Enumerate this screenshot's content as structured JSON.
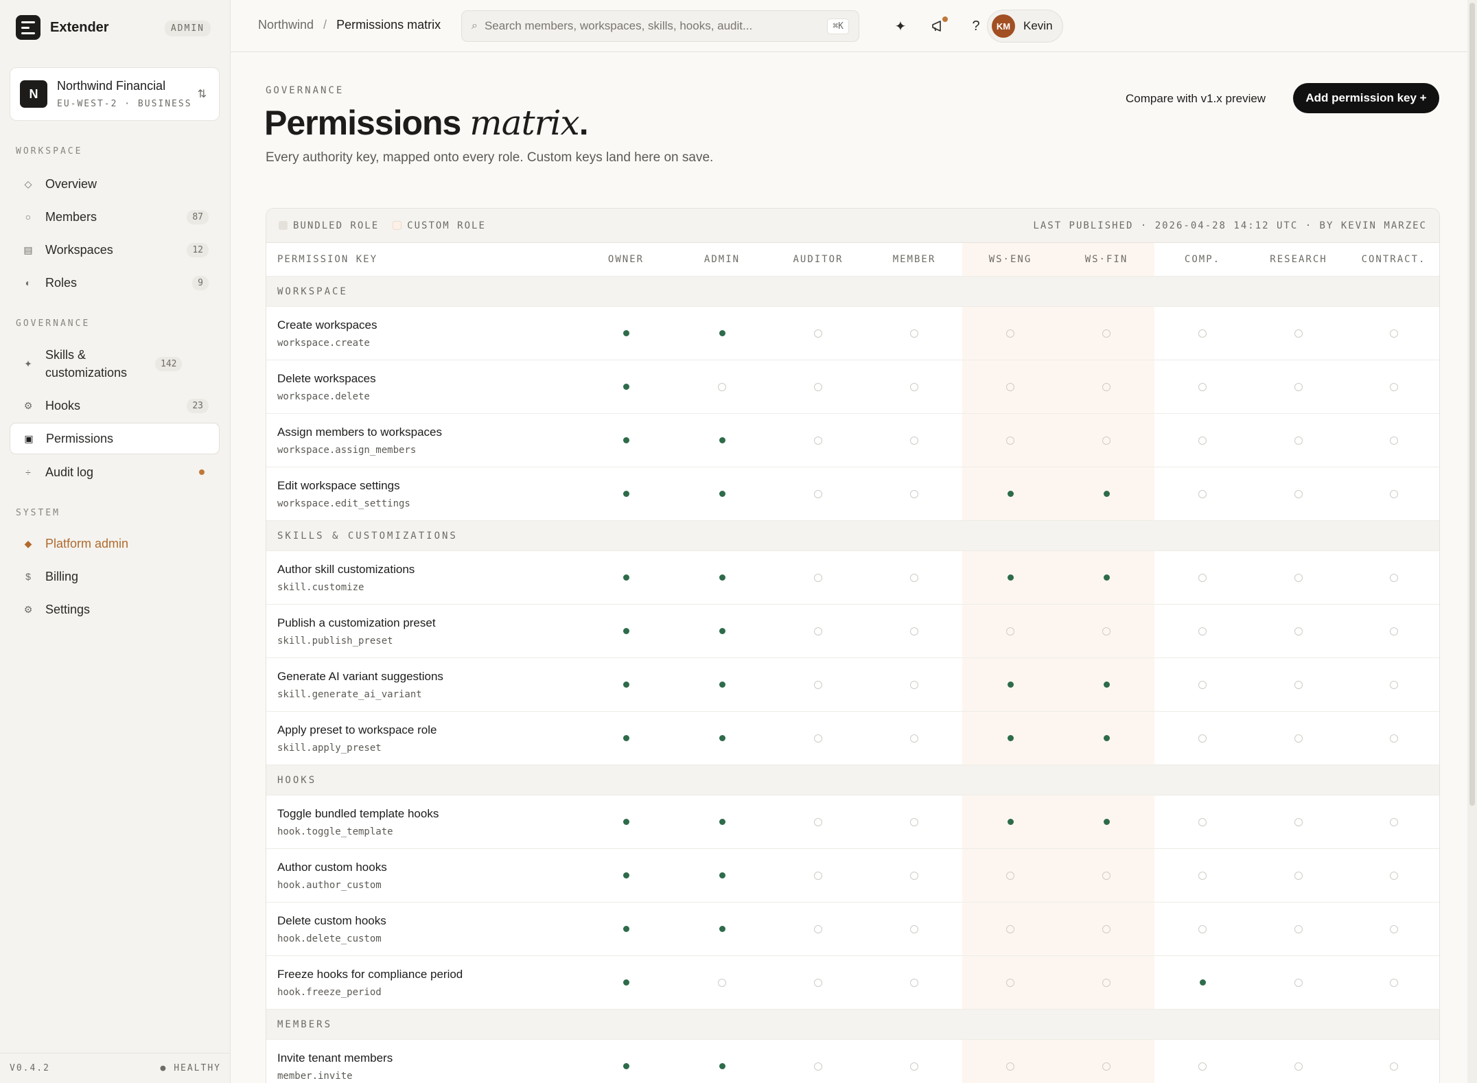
{
  "app": {
    "name": "Extender",
    "role_chip": "ADMIN",
    "version": "V0.4.2",
    "health": "● HEALTHY"
  },
  "tenant": {
    "name": "Northwind Financial",
    "meta": "EU-WEST-2 · BUSINESS",
    "initial": "N",
    "switch_icon": "⇅"
  },
  "nav": {
    "workspace_title": "WORKSPACE",
    "workspace_items": [
      {
        "label": "Overview",
        "icon": "◇",
        "count": ""
      },
      {
        "label": "Members",
        "icon": "○",
        "count": "87"
      },
      {
        "label": "Workspaces",
        "icon": "▤",
        "count": "12"
      },
      {
        "label": "Roles",
        "icon": "◐",
        "count": "9"
      }
    ],
    "governance_title": "GOVERNANCE",
    "governance_items": [
      {
        "label": "Skills & customizations",
        "icon": "✦",
        "count": "142"
      },
      {
        "label": "Hooks",
        "icon": "⚙",
        "count": "23"
      },
      {
        "label": "Permissions",
        "icon": "▣",
        "count": ""
      },
      {
        "label": "Audit log",
        "icon": "÷",
        "count": ""
      }
    ],
    "system_title": "SYSTEM",
    "system_items": [
      {
        "label": "Platform admin",
        "icon": "◆"
      },
      {
        "label": "Billing",
        "icon": "$"
      },
      {
        "label": "Settings",
        "icon": "⚙"
      }
    ]
  },
  "topbar": {
    "breadcrumb_root": "Northwind",
    "breadcrumb_sep": "/",
    "breadcrumb_current": "Permissions matrix",
    "search_placeholder": "Search members, workspaces, skills, hooks, audit...",
    "search_shortcut": "⌘K",
    "user_initials": "KM",
    "user_name": "Kevin"
  },
  "header": {
    "eyebrow": "GOVERNANCE",
    "title_main": "Permissions",
    "title_em": "matrix",
    "title_end": ".",
    "subtitle": "Every authority key, mapped onto every role. Custom keys land here on save.",
    "compare_label": "Compare with v1.x preview",
    "add_label": "Add permission key +"
  },
  "legend": {
    "bundled": "BUNDLED ROLE",
    "custom": "CUSTOM ROLE",
    "published": "LAST PUBLISHED · 2026-04-28 14:12 UTC · BY KEVIN MARZEC"
  },
  "matrix": {
    "key_header": "PERMISSION KEY",
    "roles": [
      "OWNER",
      "ADMIN",
      "AUDITOR",
      "MEMBER",
      "WS·ENG",
      "WS·FIN",
      "COMP.",
      "RESEARCH",
      "CONTRACT."
    ],
    "groups": [
      {
        "title": "WORKSPACE",
        "rows": [
          {
            "name": "Create workspaces",
            "key": "workspace.create",
            "grants": [
              1,
              1,
              0,
              0,
              0,
              0,
              0,
              0,
              0
            ]
          },
          {
            "name": "Delete workspaces",
            "key": "workspace.delete",
            "grants": [
              1,
              0,
              0,
              0,
              0,
              0,
              0,
              0,
              0
            ]
          },
          {
            "name": "Assign members to workspaces",
            "key": "workspace.assign_members",
            "grants": [
              1,
              1,
              0,
              0,
              0,
              0,
              0,
              0,
              0
            ]
          },
          {
            "name": "Edit workspace settings",
            "key": "workspace.edit_settings",
            "grants": [
              1,
              1,
              0,
              0,
              1,
              1,
              0,
              0,
              0
            ]
          }
        ]
      },
      {
        "title": "SKILLS & CUSTOMIZATIONS",
        "rows": [
          {
            "name": "Author skill customizations",
            "key": "skill.customize",
            "grants": [
              1,
              1,
              0,
              0,
              1,
              1,
              0,
              0,
              0
            ]
          },
          {
            "name": "Publish a customization preset",
            "key": "skill.publish_preset",
            "grants": [
              1,
              1,
              0,
              0,
              0,
              0,
              0,
              0,
              0
            ]
          },
          {
            "name": "Generate AI variant suggestions",
            "key": "skill.generate_ai_variant",
            "grants": [
              1,
              1,
              0,
              0,
              1,
              1,
              0,
              0,
              0
            ]
          },
          {
            "name": "Apply preset to workspace role",
            "key": "skill.apply_preset",
            "grants": [
              1,
              1,
              0,
              0,
              1,
              1,
              0,
              0,
              0
            ]
          }
        ]
      },
      {
        "title": "HOOKS",
        "rows": [
          {
            "name": "Toggle bundled template hooks",
            "key": "hook.toggle_template",
            "grants": [
              1,
              1,
              0,
              0,
              1,
              1,
              0,
              0,
              0
            ]
          },
          {
            "name": "Author custom hooks",
            "key": "hook.author_custom",
            "grants": [
              1,
              1,
              0,
              0,
              0,
              0,
              0,
              0,
              0
            ]
          },
          {
            "name": "Delete custom hooks",
            "key": "hook.delete_custom",
            "grants": [
              1,
              1,
              0,
              0,
              0,
              0,
              0,
              0,
              0
            ]
          },
          {
            "name": "Freeze hooks for compliance period",
            "key": "hook.freeze_period",
            "grants": [
              1,
              0,
              0,
              0,
              0,
              0,
              1,
              0,
              0
            ]
          }
        ]
      },
      {
        "title": "MEMBERS",
        "rows": [
          {
            "name": "Invite tenant members",
            "key": "member.invite",
            "grants": [
              1,
              1,
              0,
              0,
              0,
              0,
              0,
              0,
              0
            ]
          }
        ]
      }
    ]
  }
}
